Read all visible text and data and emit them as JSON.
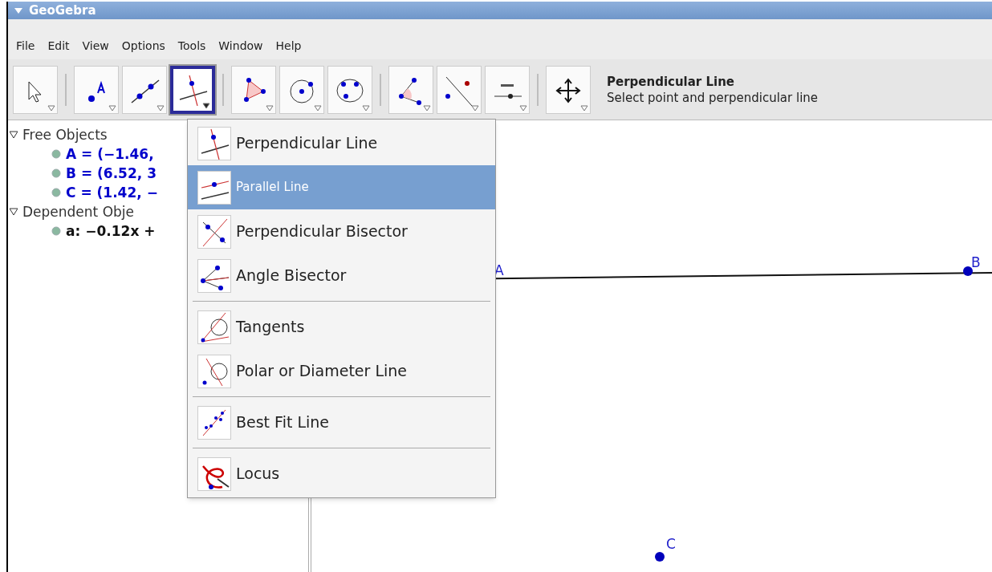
{
  "window": {
    "title": "GeoGebra"
  },
  "menu_bar": [
    "File",
    "Edit",
    "View",
    "Options",
    "Tools",
    "Window",
    "Help"
  ],
  "toolbar": {
    "groups": [
      [
        {
          "kind": "select",
          "selected": false
        }
      ],
      [
        {
          "kind": "point",
          "selected": false
        },
        {
          "kind": "line",
          "selected": false
        },
        {
          "kind": "perpendicular",
          "selected": true
        }
      ],
      [
        {
          "kind": "polygon",
          "selected": false
        },
        {
          "kind": "circle",
          "selected": false
        },
        {
          "kind": "conic",
          "selected": false
        }
      ],
      [
        {
          "kind": "angle",
          "selected": false
        },
        {
          "kind": "reflect",
          "selected": false
        },
        {
          "kind": "slider",
          "selected": false
        }
      ],
      [
        {
          "kind": "move",
          "selected": false
        }
      ]
    ],
    "tool_name": "Perpendicular Line",
    "tool_help": "Select point and perpendicular line"
  },
  "algebra": [
    {
      "label": "Free Objects",
      "expanded": true,
      "children": [
        {
          "label": "A = (−1.46,",
          "color": "#0000cc"
        },
        {
          "label": "B = (6.52, 3",
          "color": "#0000cc"
        },
        {
          "label": "C = (1.42, −",
          "color": "#0000cc"
        }
      ]
    },
    {
      "label": "Dependent Obje",
      "expanded": true,
      "children": [
        {
          "label": "a: −0.12x +",
          "color": "#111111"
        }
      ]
    }
  ],
  "tool_menu": [
    [
      {
        "label": "Perpendicular Line",
        "kind": "perpendicular",
        "selected": false
      },
      {
        "label": "Parallel Line",
        "kind": "parallel",
        "selected": true
      },
      {
        "label": "Perpendicular Bisector",
        "kind": "bisector",
        "selected": false
      },
      {
        "label": "Angle Bisector",
        "kind": "angle_bisector",
        "selected": false
      }
    ],
    [
      {
        "label": "Tangents",
        "kind": "tangents",
        "selected": false
      },
      {
        "label": "Polar or Diameter Line",
        "kind": "polar",
        "selected": false
      }
    ],
    [
      {
        "label": "Best Fit Line",
        "kind": "fit",
        "selected": false
      }
    ],
    [
      {
        "label": "Locus",
        "kind": "locus",
        "selected": false
      }
    ]
  ],
  "graphics": {
    "points": [
      {
        "label": "A",
        "dot": false
      },
      {
        "label": "B",
        "dot": true
      },
      {
        "label": "C",
        "dot": true
      }
    ]
  }
}
